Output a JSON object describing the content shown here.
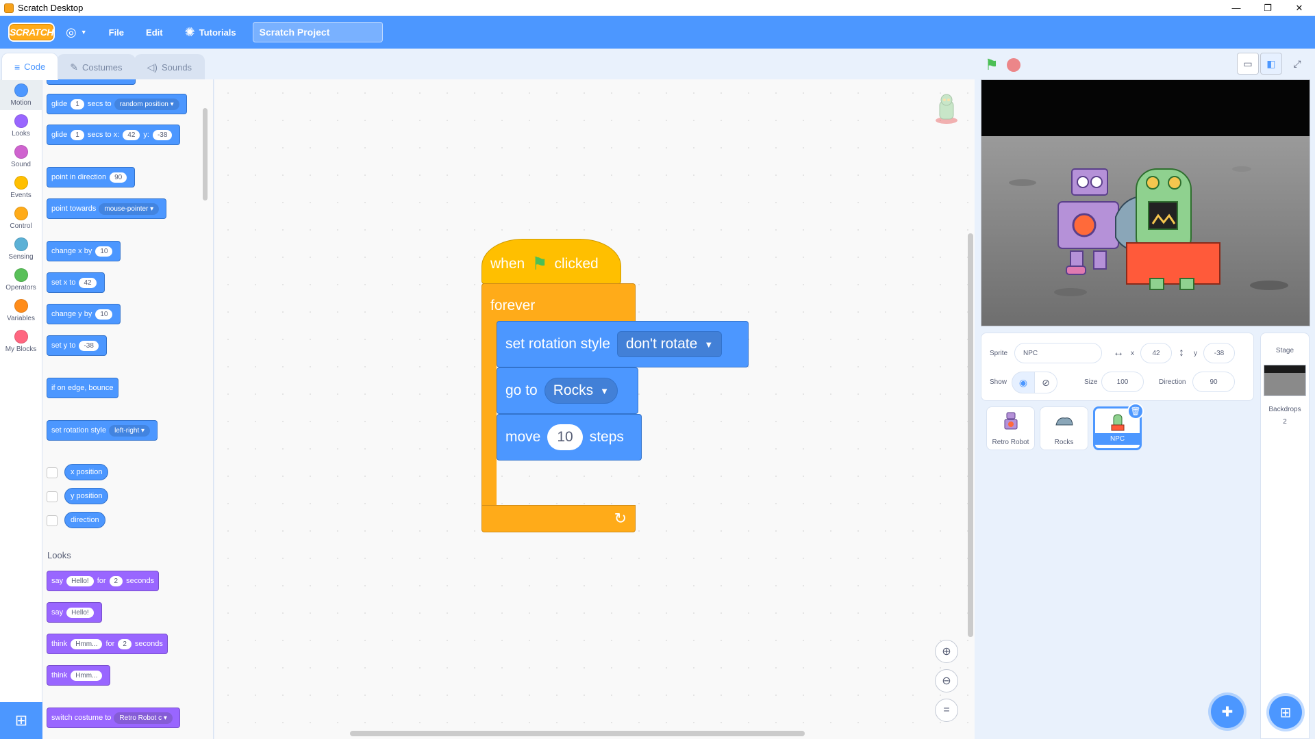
{
  "window": {
    "title": "Scratch Desktop",
    "minimize": "—",
    "restore": "❐",
    "close": "✕"
  },
  "menubar": {
    "logo": "SCRATCH",
    "language_icon": "◎",
    "file": "File",
    "edit": "Edit",
    "tutorials": "Tutorials",
    "project_title": "Scratch Project"
  },
  "tabs": [
    {
      "label": "Code",
      "icon": "≡"
    },
    {
      "label": "Costumes",
      "icon": "✎"
    },
    {
      "label": "Sounds",
      "icon": "◁)"
    }
  ],
  "categories": [
    {
      "label": "Motion",
      "color": "#4c97ff"
    },
    {
      "label": "Looks",
      "color": "#9966ff"
    },
    {
      "label": "Sound",
      "color": "#cf63cf"
    },
    {
      "label": "Events",
      "color": "#ffbf00"
    },
    {
      "label": "Control",
      "color": "#ffab19"
    },
    {
      "label": "Sensing",
      "color": "#5cb1d6"
    },
    {
      "label": "Operators",
      "color": "#59c059"
    },
    {
      "label": "Variables",
      "color": "#ff8c1a"
    },
    {
      "label": "My Blocks",
      "color": "#ff6680"
    }
  ],
  "palette": {
    "glide_random": {
      "a": "glide",
      "n": "1",
      "b": "secs to",
      "dd": "random position"
    },
    "glide_xy": {
      "a": "glide",
      "n": "1",
      "b": "secs to x:",
      "x": "42",
      "c": "y:",
      "y": "-38"
    },
    "point_dir": {
      "a": "point in direction",
      "n": "90"
    },
    "point_towards": {
      "a": "point towards",
      "dd": "mouse-pointer"
    },
    "change_x": {
      "a": "change x by",
      "n": "10"
    },
    "set_x": {
      "a": "set x to",
      "n": "42"
    },
    "change_y": {
      "a": "change y by",
      "n": "10"
    },
    "set_y": {
      "a": "set y to",
      "n": "-38"
    },
    "bounce": {
      "a": "if on edge, bounce"
    },
    "rotation": {
      "a": "set rotation style",
      "dd": "left-right"
    },
    "rep_x": "x position",
    "rep_y": "y position",
    "rep_dir": "direction",
    "looks_heading": "Looks",
    "say_for": {
      "a": "say",
      "t": "Hello!",
      "b": "for",
      "n": "2",
      "c": "seconds"
    },
    "say": {
      "a": "say",
      "t": "Hello!"
    },
    "think_for": {
      "a": "think",
      "t": "Hmm...",
      "b": "for",
      "n": "2",
      "c": "seconds"
    },
    "think": {
      "a": "think",
      "t": "Hmm..."
    },
    "switch_costume": {
      "a": "switch costume to",
      "dd": "Retro Robot c"
    }
  },
  "script": {
    "hat_when": "when",
    "hat_clicked": "clicked",
    "forever": "forever",
    "rotation_label": "set rotation style",
    "rotation_value": "don't rotate",
    "goto_label": "go to",
    "goto_value": "Rocks",
    "move_label": "move",
    "move_value": "10",
    "move_suffix": "steps"
  },
  "zoom": {
    "in": "⊕",
    "out": "⊖",
    "reset": "="
  },
  "stage_controls": {
    "flag": "⚑"
  },
  "sprite_info": {
    "sprite_label": "Sprite",
    "sprite_name": "NPC",
    "x_label": "x",
    "x": "42",
    "y_label": "y",
    "y": "-38",
    "show_label": "Show",
    "size_label": "Size",
    "size": "100",
    "direction_label": "Direction",
    "direction": "90"
  },
  "sprites": [
    {
      "name": "Retro Robot",
      "selected": false
    },
    {
      "name": "Rocks",
      "selected": false
    },
    {
      "name": "NPC",
      "selected": true
    }
  ],
  "stage_target": {
    "label": "Stage",
    "backdrops_label": "Backdrops",
    "backdrops_count": "2"
  },
  "colors": {
    "motion": "#4c97ff",
    "looks": "#9966ff",
    "events": "#ffbf00",
    "control": "#ffab19",
    "accent": "#4c97ff"
  }
}
